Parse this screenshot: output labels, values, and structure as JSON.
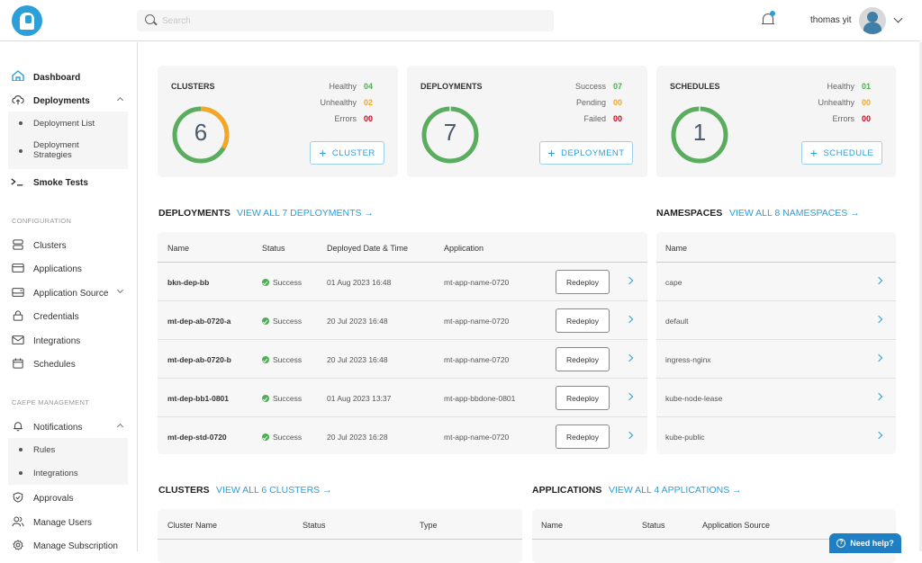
{
  "header": {
    "search_placeholder": "Search",
    "notification_count": "1",
    "user_name": "thomas yit"
  },
  "sidebar": {
    "dashboard": "Dashboard",
    "deployments": "Deployments",
    "deployments_sub": [
      "Deployment List",
      "Deployment\nStrategies"
    ],
    "smoke_tests": "Smoke Tests",
    "section_configuration": "CONFIGURATION",
    "config_items": [
      "Clusters",
      "Applications",
      "Application Source",
      "Credentials",
      "Integrations",
      "Schedules"
    ],
    "section_management": "CAEPE MANAGEMENT",
    "notifications": "Notifications",
    "notifications_sub": [
      "Rules",
      "Integrations"
    ],
    "mgmt_items": [
      "Approvals",
      "Manage Users",
      "Manage Subscription"
    ]
  },
  "cards": {
    "clusters": {
      "title": "CLUSTERS",
      "total": "6",
      "stats": [
        {
          "label": "Healthy",
          "value": "04"
        },
        {
          "label": "Unhealthy",
          "value": "02"
        },
        {
          "label": "Errors",
          "value": "00"
        }
      ],
      "button": "CLUSTER"
    },
    "deployments": {
      "title": "DEPLOYMENTS",
      "total": "7",
      "stats": [
        {
          "label": "Success",
          "value": "07"
        },
        {
          "label": "Pending",
          "value": "00"
        },
        {
          "label": "Failed",
          "value": "00"
        }
      ],
      "button": "DEPLOYMENT"
    },
    "schedules": {
      "title": "SCHEDULES",
      "total": "1",
      "stats": [
        {
          "label": "Healthy",
          "value": "01"
        },
        {
          "label": "Unhealthy",
          "value": "00"
        },
        {
          "label": "Errors",
          "value": "00"
        }
      ],
      "button": "SCHEDULE"
    }
  },
  "colors": {
    "healthy": "#4caf50",
    "warning": "#f5a623",
    "error": "#d0021b",
    "accent": "#2b9fd8"
  },
  "deployments_table": {
    "title": "DEPLOYMENTS",
    "view_all": "VIEW ALL 7 DEPLOYMENTS →",
    "columns": [
      "Name",
      "Status",
      "Deployed Date & Time",
      "Application"
    ],
    "action_label": "Redeploy",
    "rows": [
      {
        "name": "bkn-dep-bb",
        "status": "Success",
        "date": "01 Aug 2023 16:48",
        "app": "mt-app-name-0720"
      },
      {
        "name": "mt-dep-ab-0720-a",
        "status": "Success",
        "date": "20 Jul 2023 16:48",
        "app": "mt-app-name-0720"
      },
      {
        "name": "mt-dep-ab-0720-b",
        "status": "Success",
        "date": "20 Jul 2023 16:48",
        "app": "mt-app-name-0720"
      },
      {
        "name": "mt-dep-bb1-0801",
        "status": "Success",
        "date": "01 Aug 2023 13:37",
        "app": "mt-app-bbdone-0801"
      },
      {
        "name": "mt-dep-std-0720",
        "status": "Success",
        "date": "20 Jul 2023 16:28",
        "app": "mt-app-name-0720"
      }
    ]
  },
  "namespaces_table": {
    "title": "NAMESPACES",
    "view_all": "VIEW ALL 8 NAMESPACES →",
    "columns": [
      "Name"
    ],
    "rows": [
      "cape",
      "default",
      "ingress-nginx",
      "kube-node-lease",
      "kube-public"
    ]
  },
  "clusters_table": {
    "title": "CLUSTERS",
    "view_all": "VIEW ALL 6 CLUSTERS →",
    "columns": [
      "Cluster Name",
      "Status",
      "Type"
    ]
  },
  "applications_table": {
    "title": "APPLICATIONS",
    "view_all": "VIEW ALL 4 APPLICATIONS →",
    "columns": [
      "Name",
      "Status",
      "Application Source"
    ]
  },
  "help_button": "Need help?"
}
